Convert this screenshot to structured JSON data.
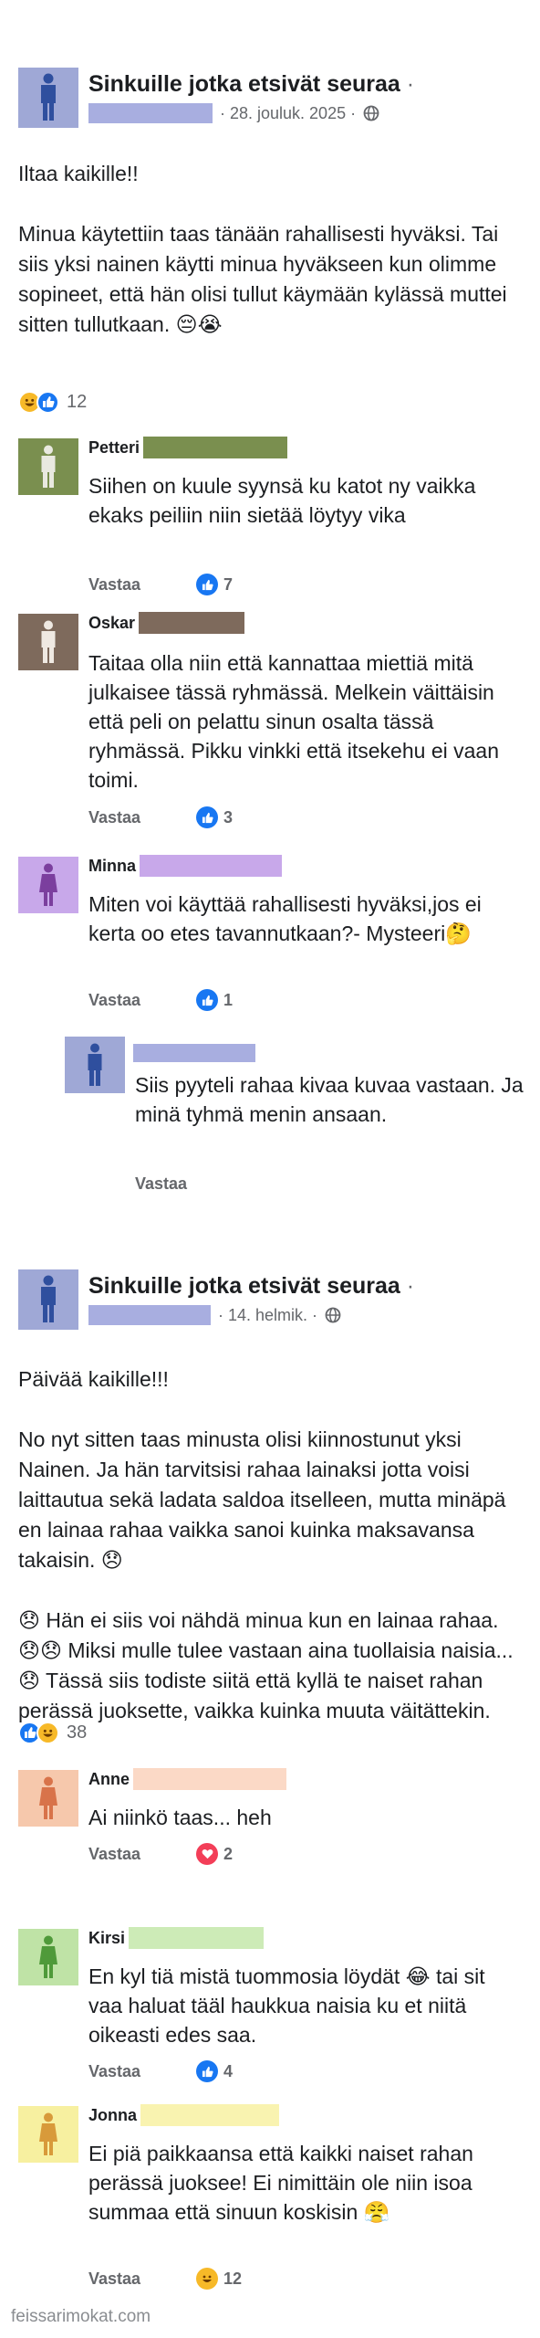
{
  "posts": [
    {
      "group_name": "Sinkuille jotka etsivät seuraa",
      "dot": "·",
      "date": "· 28. jouluk. 2025 ·",
      "paragraphs": [
        "Iltaa kaikille!!",
        "Minua käytettiin taas tänään rahallisesti hyväksi. Tai siis yksi nainen käytti minua hyväkseen kun olimme sopineet, että hän olisi tullut käymään kylässä muttei sitten tullutkaan. 😔😭"
      ],
      "reactions": {
        "icons": [
          "haha",
          "like"
        ],
        "count": "12"
      },
      "comments": [
        {
          "name": "Petteri",
          "text": "Siihen on kuule syynsä ku katot ny vaikka ekaks peiliin niin sietää löytyy vika",
          "reply": "Vastaa",
          "reaction": "like",
          "likes": "7",
          "avatar_color": "#7a8f4f",
          "redact_color": "#7a8f4f"
        },
        {
          "name": "Oskar",
          "text": "Taitaa olla niin että kannattaa miettiä mitä julkaisee tässä ryhmässä. Melkein väittäisin että peli on pelattu sinun osalta tässä ryhmässä. Pikku vinkki että itsekehu ei vaan toimi.",
          "reply": "Vastaa",
          "reaction": "like",
          "likes": "3",
          "avatar_color": "#7e6a5c",
          "redact_color": "#7e6a5c"
        },
        {
          "name": "Minna",
          "text": "Miten voi käyttää rahallisesti hyväksi,jos ei kerta oo etes tavannutkaan?- Mysteeri🤔",
          "reply": "Vastaa",
          "reaction": "like",
          "likes": "1",
          "avatar_color": "#c8a8ea",
          "redact_color": "#c8a8ea"
        },
        {
          "name": "",
          "text": "Siis pyyteli rahaa kivaa kuvaa vastaan. Ja minä tyhmä menin ansaan.",
          "reply": "Vastaa",
          "reaction": "",
          "likes": "",
          "avatar_color": "#9fa8d6",
          "redact_color": "#a8aee0"
        }
      ]
    },
    {
      "group_name": "Sinkuille jotka etsivät seuraa",
      "dot": "·",
      "date": "· 14. helmik. ·",
      "paragraphs": [
        "Päivää kaikille!!!",
        "No nyt sitten taas minusta olisi kiinnostunut yksi Nainen. Ja hän tarvitsisi rahaa lainaksi jotta voisi laittautua sekä ladata saldoa itselleen, mutta minäpä en lainaa rahaa vaikka sanoi kuinka maksavansa takaisin. 😞",
        "😞 Hän ei siis voi nähdä minua kun en lainaa rahaa. 😞😞 Miksi mulle tulee vastaan aina tuollaisia naisia... 😞 Tässä siis todiste siitä että kyllä te naiset rahan perässä juoksette, vaikka kuinka muuta väitättekin."
      ],
      "reactions": {
        "icons": [
          "like",
          "haha"
        ],
        "count": "38"
      },
      "comments": [
        {
          "name": "Anne",
          "text": "Ai niinkö taas... heh",
          "reply": "Vastaa",
          "reaction": "love",
          "likes": "2",
          "avatar_color": "#f6c8ac",
          "redact_color": "#fbd9c6"
        },
        {
          "name": "Kirsi",
          "text": "En kyl tiä mistä tuommosia löydät 😂 tai sit vaa haluat tääl haukkua naisia ku et niitä oikeasti edes saa.",
          "reply": "Vastaa",
          "reaction": "like",
          "likes": "4",
          "avatar_color": "#bfe3a6",
          "redact_color": "#cdebb7"
        },
        {
          "name": "Jonna",
          "text": "Ei piä paikkaansa että kaikki naiset rahan perässä juoksee! Ei nimittäin ole niin isoa summaa että sinuun koskisin 😤",
          "reply": "Vastaa",
          "reaction": "haha",
          "likes": "12",
          "avatar_color": "#f7f0a0",
          "redact_color": "#f9f3b0"
        }
      ]
    }
  ],
  "watermark": "feissarimokat.com",
  "colors": {
    "like": "#1877f2",
    "love": "#f33e58",
    "haha": "#f7b928",
    "meta": "#65676b"
  }
}
